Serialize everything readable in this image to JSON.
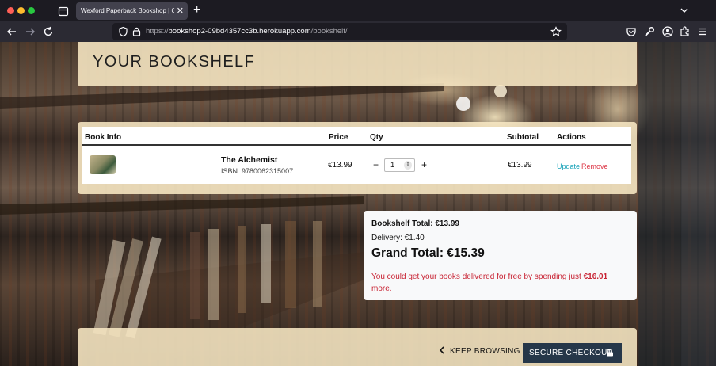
{
  "browser": {
    "tab_title": "Wexford Paperback Bookshop | Qua",
    "tab_close": "✕",
    "new_tab": "+",
    "url_scheme": "https://",
    "url_host": "bookshop2-09bd4357cc3b.herokuapp.com",
    "url_path": "/bookshelf/"
  },
  "page": {
    "heading": "YOUR BOOKSHELF"
  },
  "table": {
    "headers": [
      "Book Info",
      "Price",
      "Qty",
      "Subtotal",
      "Actions"
    ],
    "rows": [
      {
        "title": "The Alchemist",
        "isbn": "ISBN: 9780062315007",
        "price": "€13.99",
        "qty": "1",
        "subtotal": "€13.99",
        "update_label": "Update",
        "remove_label": "Remove"
      }
    ],
    "qty_minus": "−",
    "qty_plus": "+"
  },
  "totals": {
    "bookshelf_total": "Bookshelf Total: €13.99",
    "delivery": "Delivery: €1.40",
    "grand_total": "Grand Total: €15.39",
    "free_delivery_prefix": "You could get your books delivered for free by spending just ",
    "free_delivery_amount": "€16.01",
    "free_delivery_suffix": " more."
  },
  "footer": {
    "keep_browsing": "KEEP BROWSING",
    "secure_checkout": "SECURE CHECKOUT"
  },
  "colors": {
    "card_bg": "#f8e8c4",
    "checkout_bg": "#263749",
    "update_link": "#17a2b8",
    "remove_link": "#dc3545",
    "notice_text": "#c82333"
  }
}
